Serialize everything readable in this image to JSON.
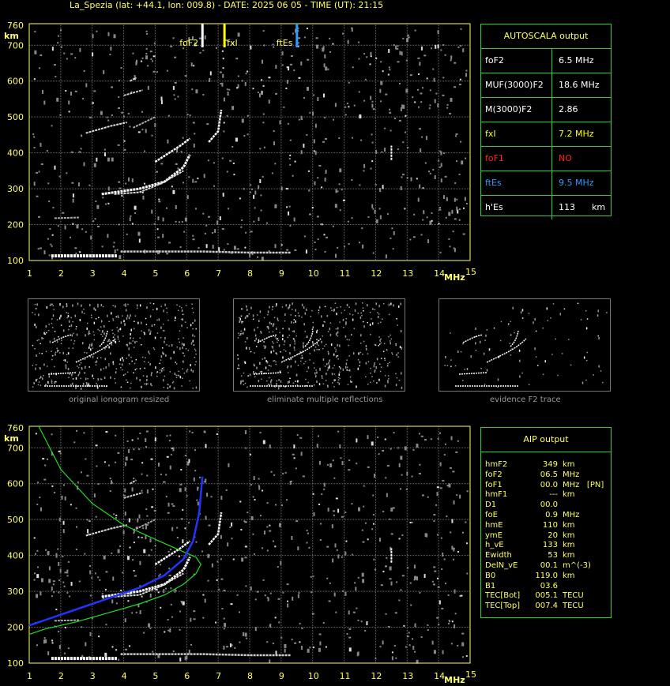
{
  "title": "La_Spezia (lat: +44.1, lon: 009.8) - DATE: 2025 06 05 - TIME (UT): 21:15",
  "colors": {
    "axis": "#ffff66",
    "grid": "#888888",
    "frame": "#33cc33",
    "trace": "#ffffff",
    "profile_green": "#22dd22",
    "profile_blue": "#2233ff",
    "red": "#ff2222",
    "blue": "#3399ff",
    "yellow": "#ffff00"
  },
  "chart_data": [
    {
      "type": "scatter",
      "panel": "top ionogram",
      "xlabel": "MHz",
      "ylabel": "km",
      "xlim": [
        1,
        15
      ],
      "ylim": [
        100,
        760
      ],
      "xticks": [
        "1",
        "2",
        "3",
        "4",
        "5",
        "6",
        "7",
        "8",
        "9",
        "10",
        "11",
        "12",
        "13",
        "14",
        "15"
      ],
      "yticks": [
        "100",
        "200",
        "300",
        "400",
        "500",
        "600",
        "700",
        "760"
      ],
      "grid": true,
      "markers": [
        {
          "label": "foF2",
          "x": 6.5,
          "color": "#ffffff"
        },
        {
          "label": "fxI",
          "x": 7.2,
          "color": "#ffff00"
        },
        {
          "label": "ftEs",
          "x": 9.5,
          "color": "#3399ff"
        }
      ]
    },
    {
      "type": "line",
      "panel": "bottom ionogram with AIP profile",
      "xlabel": "MHz",
      "ylabel": "km",
      "xlim": [
        1,
        15
      ],
      "ylim": [
        100,
        760
      ],
      "xticks": [
        "1",
        "2",
        "3",
        "4",
        "5",
        "6",
        "7",
        "8",
        "9",
        "10",
        "11",
        "12",
        "13",
        "14",
        "15"
      ],
      "yticks": [
        "100",
        "200",
        "300",
        "400",
        "500",
        "600",
        "700",
        "760"
      ],
      "grid": true,
      "series": [
        {
          "color": "#22dd22",
          "x": [
            1.0,
            1.5,
            2.5,
            3.5,
            4.5,
            5.3,
            5.9,
            6.3,
            6.45,
            6.3,
            5.9,
            5.0,
            4.0,
            3.0,
            2.0,
            1.3
          ],
          "y": [
            180,
            195,
            215,
            240,
            265,
            290,
            320,
            350,
            375,
            395,
            410,
            445,
            485,
            545,
            640,
            760
          ]
        },
        {
          "color": "#2233ff",
          "x": [
            1.0,
            1.5,
            2.5,
            3.5,
            4.5,
            5.3,
            5.9,
            6.2,
            6.4,
            6.5
          ],
          "y": [
            205,
            220,
            250,
            280,
            310,
            345,
            390,
            440,
            520,
            620
          ]
        }
      ]
    }
  ],
  "thumbnails": [
    {
      "caption": "original ionogram resized"
    },
    {
      "caption": "eliminate multiple reflections"
    },
    {
      "caption": "evidence F2 trace"
    }
  ],
  "autoscala": {
    "header": "AUTOSCALA output",
    "rows": [
      {
        "key": "foF2",
        "value": "6.5 MHz",
        "color": "#ffffff"
      },
      {
        "key": "MUF(3000)F2",
        "value": "18.6 MHz",
        "color": "#ffffff"
      },
      {
        "key": "M(3000)F2",
        "value": "2.86",
        "color": "#ffffff"
      },
      {
        "key": "fxI",
        "value": "7.2 MHz",
        "color": "#ffff00"
      },
      {
        "key": "foF1",
        "value": "NO",
        "color": "#ff2222"
      },
      {
        "key": "ftEs",
        "value": "9.5 MHz",
        "color": "#3399ff"
      },
      {
        "key": "h'Es",
        "value": "113      km",
        "color": "#ffffff"
      }
    ]
  },
  "aip": {
    "header": "AIP output",
    "rows": [
      {
        "k": "hmF2",
        "v": "349",
        "u": "km"
      },
      {
        "k": "foF2",
        "v": "06.5",
        "u": "MHz"
      },
      {
        "k": "foF1",
        "v": "00.0",
        "u": "MHz   [PN]"
      },
      {
        "k": "hmF1",
        "v": "---",
        "u": "km"
      },
      {
        "k": "D1",
        "v": "00.0",
        "u": ""
      },
      {
        "k": "foE",
        "v": "0.9",
        "u": "MHz"
      },
      {
        "k": "hmE",
        "v": "110",
        "u": "km"
      },
      {
        "k": "ymE",
        "v": "20",
        "u": "km"
      },
      {
        "k": "h_vE",
        "v": "133",
        "u": "km"
      },
      {
        "k": "Ewidth",
        "v": "53",
        "u": "km"
      },
      {
        "k": "DelN_vE",
        "v": "00.1",
        "u": "m^(-3)"
      },
      {
        "k": "B0",
        "v": "119.0",
        "u": "km"
      },
      {
        "k": "B1",
        "v": "03.6",
        "u": ""
      },
      {
        "k": "TEC[Bot]",
        "v": "005.1",
        "u": "TECU"
      },
      {
        "k": "TEC[Top]",
        "v": "007.4",
        "u": "TECU"
      }
    ]
  }
}
